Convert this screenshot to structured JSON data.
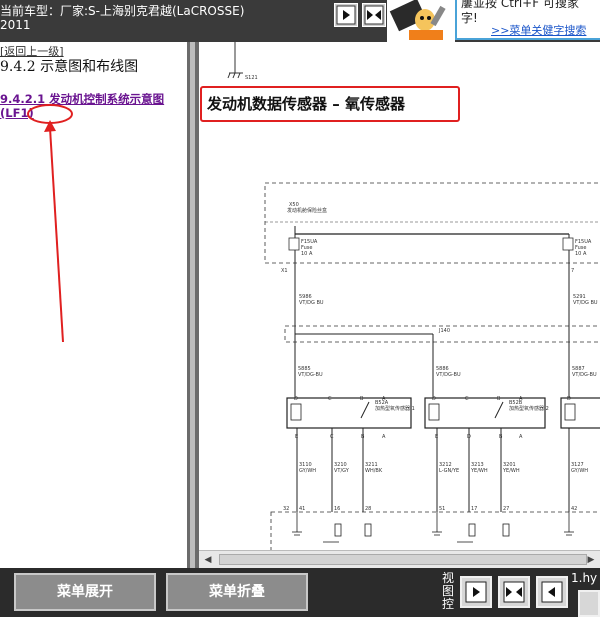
{
  "header": {
    "vehicle_line": "当前车型：厂家:S-上海别克君越(LaCROSSE)",
    "year": "2011",
    "tip_text_1": "屢並按   Ctrl+F   可搜家",
    "tip_text_2": "字!",
    "tip_link": ">>菜单关健字搜索"
  },
  "left_panel": {
    "back_link": "[返回上一级]",
    "section_title": "9.4.2 示意图和布线图",
    "nav_link": "9.4.2.1 发动机控制系统示意图 (LF1)"
  },
  "diagram": {
    "title": "发动机数据传感器 – 氧传感器",
    "top_ground": "S121",
    "fuse_block_label": "发动机舱保险丝盒",
    "fuse_connector_top": "X50",
    "fuse_left": {
      "name": "F15UA",
      "type": "Fuse",
      "rating": "10 A"
    },
    "fuse_right": {
      "name": "F15UA",
      "type": "Fuse",
      "rating": "10 A"
    },
    "pin_left": "X1",
    "pin_right": "7",
    "wire_1": {
      "circuit": "5986",
      "color": "VT/DG  BU"
    },
    "wire_2": {
      "circuit": "5291",
      "color": "VT/DG  BU"
    },
    "splice": "J140",
    "wire_3": {
      "circuit": "5885",
      "color": "VT/DG-BU"
    },
    "wire_4": {
      "circuit": "5886",
      "color": "VT/DG-BU"
    },
    "wire_5": {
      "circuit": "5887",
      "color": "VT/DG-BU"
    },
    "sensor_1": {
      "code": "B52A",
      "label": "加热型氧传感器 1",
      "pins": [
        "D",
        "C",
        "B",
        "A"
      ]
    },
    "sensor_2": {
      "code": "B52B",
      "label": "加热型氧传感器 2",
      "pins": [
        "D",
        "C",
        "B",
        "A"
      ]
    },
    "sensor_3_pin": "D",
    "bottom_pins_1": [
      "E",
      "C",
      "B",
      "A"
    ],
    "bottom_pins_2": [
      "E",
      "D",
      "B",
      "A"
    ],
    "signal_wires": [
      {
        "circuit": "3110",
        "color": "GY/WH"
      },
      {
        "circuit": "3210",
        "color": "VT/GY"
      },
      {
        "circuit": "3211",
        "color": "WH/BK"
      },
      {
        "circuit": "3212",
        "color": "L-GN/YE"
      },
      {
        "circuit": "3213",
        "color": "YE/WH"
      },
      {
        "circuit": "3201",
        "color": "YE/WH"
      },
      {
        "circuit": "3127",
        "color": "GY/WH"
      }
    ],
    "ecm_pins": [
      "32",
      "41",
      "16",
      "28",
      "51",
      "17",
      "27",
      "42"
    ]
  },
  "bottom": {
    "expand_button": "菜单展开",
    "collapse_button": "菜单折叠",
    "view_control": "视图控",
    "filename": "1.hy"
  },
  "colors": {
    "header_bg": "#3a3a3a",
    "bottom_bg": "#2b2b2b",
    "annotation_red": "#e02020",
    "link_purple": "#6a1490"
  }
}
